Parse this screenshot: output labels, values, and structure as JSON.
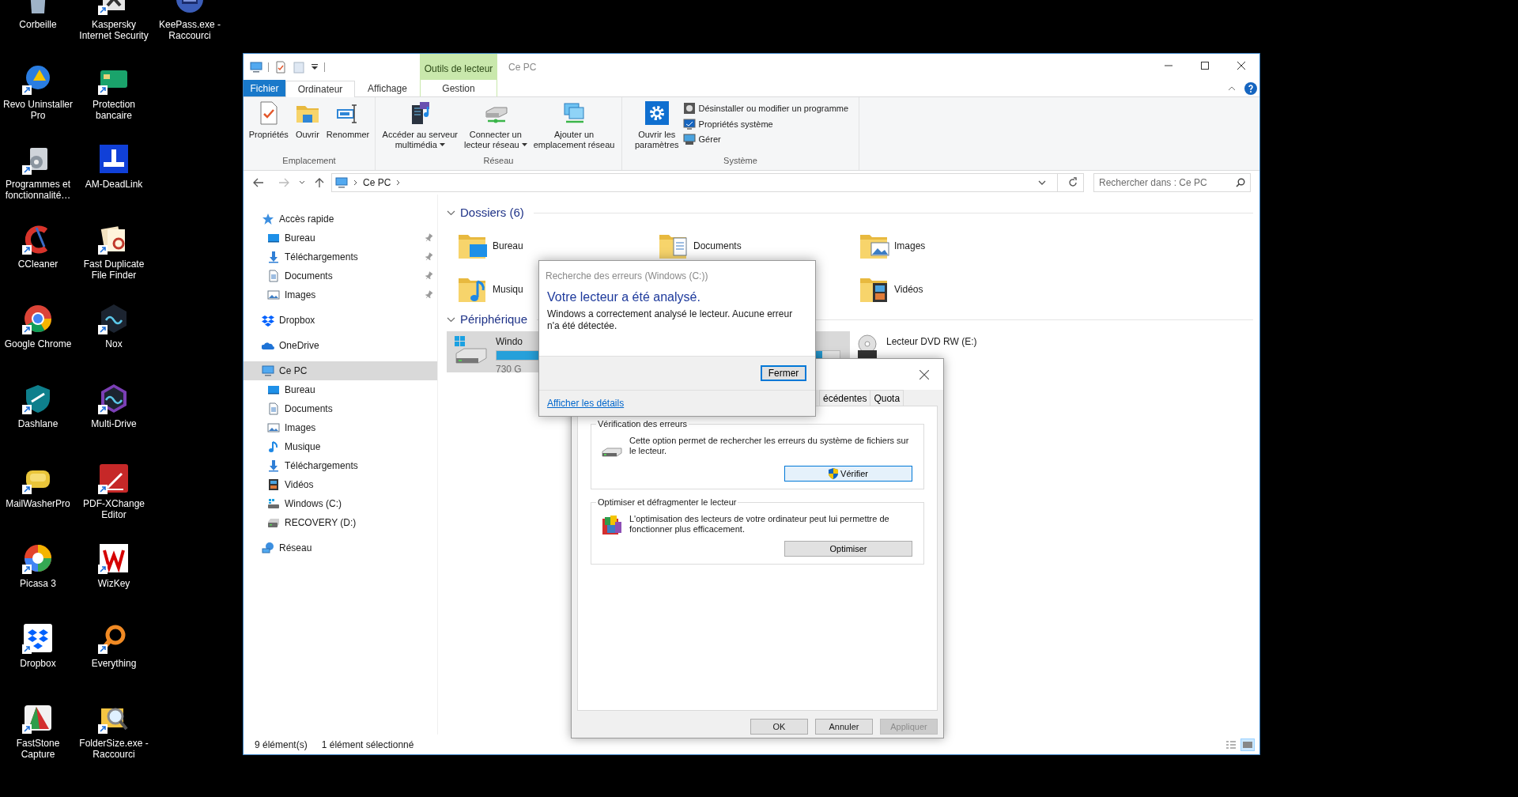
{
  "desktop": {
    "columns": [
      {
        "icons": [
          {
            "label": "Corbeille",
            "shortcut": false
          },
          {
            "label": "Revo Uninstaller Pro",
            "shortcut": true
          },
          {
            "label": "Programmes et fonctionnalité…",
            "shortcut": true
          },
          {
            "label": "CCleaner",
            "shortcut": true
          },
          {
            "label": "Google Chrome",
            "shortcut": true
          },
          {
            "label": "Dashlane",
            "shortcut": true
          },
          {
            "label": "MailWasherPro",
            "shortcut": true
          },
          {
            "label": "Picasa 3",
            "shortcut": true
          },
          {
            "label": "Dropbox",
            "shortcut": true
          },
          {
            "label": "FastStone Capture",
            "shortcut": true
          }
        ]
      },
      {
        "icons": [
          {
            "label": "Kaspersky Internet Security",
            "shortcut": true
          },
          {
            "label": "Protection bancaire",
            "shortcut": true
          },
          {
            "label": "AM-DeadLink",
            "shortcut": false
          },
          {
            "label": "Fast Duplicate File Finder",
            "shortcut": true
          },
          {
            "label": "Nox",
            "shortcut": true
          },
          {
            "label": "Multi-Drive",
            "shortcut": true
          },
          {
            "label": "PDF-XChange Editor",
            "shortcut": true
          },
          {
            "label": "WizKey",
            "shortcut": true
          },
          {
            "label": "Everything",
            "shortcut": true
          },
          {
            "label": "FolderSize.exe - Raccourci",
            "shortcut": true
          }
        ]
      },
      {
        "icons": [
          {
            "label": "KeePass.exe - Raccourci",
            "shortcut": false
          }
        ]
      }
    ]
  },
  "explorer": {
    "context_tab": "Outils de lecteur",
    "title": "Ce PC",
    "tabs": [
      {
        "label": "Fichier",
        "kind": "file",
        "selected": false
      },
      {
        "label": "Ordinateur",
        "kind": "normal",
        "selected": true
      },
      {
        "label": "Affichage",
        "kind": "normal",
        "selected": false
      },
      {
        "label": "Gestion",
        "kind": "context",
        "selected": false
      }
    ],
    "ribbon_groups": [
      {
        "title": "Emplacement",
        "items": [
          {
            "kind": "large",
            "lines": [
              "Propriétés"
            ],
            "dropdown": false
          },
          {
            "kind": "large",
            "lines": [
              "Ouvrir"
            ],
            "dropdown": false
          },
          {
            "kind": "large",
            "lines": [
              "Renommer"
            ],
            "dropdown": false
          }
        ]
      },
      {
        "title": "Réseau",
        "items": [
          {
            "kind": "large",
            "lines": [
              "Accéder au serveur",
              "multimédia"
            ],
            "dropdown": true
          },
          {
            "kind": "large",
            "lines": [
              "Connecter un",
              "lecteur réseau"
            ],
            "dropdown": true
          },
          {
            "kind": "large",
            "lines": [
              "Ajouter un",
              "emplacement réseau"
            ],
            "dropdown": false
          }
        ]
      },
      {
        "title": "Système",
        "items": [
          {
            "kind": "large",
            "lines": [
              "Ouvrir les",
              "paramètres"
            ],
            "dropdown": false
          },
          {
            "kind": "small",
            "lines": [
              "Désinstaller ou modifier un programme"
            ],
            "dropdown": false
          },
          {
            "kind": "small",
            "lines": [
              "Propriétés système"
            ],
            "dropdown": false
          },
          {
            "kind": "small",
            "lines": [
              "Gérer"
            ],
            "dropdown": false
          }
        ]
      }
    ],
    "address": {
      "crumbs": [
        "Ce PC"
      ]
    },
    "search": {
      "placeholder": "Rechercher dans : Ce PC"
    },
    "nav": [
      {
        "label": "Accès rapide",
        "kind": "star",
        "selected": false,
        "children": [
          {
            "label": "Bureau",
            "kind": "desktop",
            "pinned": true,
            "selected": false
          },
          {
            "label": "Téléchargements",
            "kind": "download",
            "pinned": true,
            "selected": false
          },
          {
            "label": "Documents",
            "kind": "document",
            "pinned": true,
            "selected": false
          },
          {
            "label": "Images",
            "kind": "images",
            "pinned": true,
            "selected": false
          }
        ]
      },
      {
        "label": "Dropbox",
        "kind": "dropbox",
        "selected": false
      },
      {
        "label": "OneDrive",
        "kind": "onedrive",
        "selected": false
      },
      {
        "label": "Ce PC",
        "kind": "pc",
        "selected": true,
        "children": [
          {
            "label": "Bureau",
            "kind": "desktop",
            "pinned": false,
            "selected": false
          },
          {
            "label": "Documents",
            "kind": "document",
            "pinned": false,
            "selected": false
          },
          {
            "label": "Images",
            "kind": "images",
            "pinned": false,
            "selected": false
          },
          {
            "label": "Musique",
            "kind": "music",
            "pinned": false,
            "selected": false
          },
          {
            "label": "Téléchargements",
            "kind": "download",
            "pinned": false,
            "selected": false
          },
          {
            "label": "Vidéos",
            "kind": "video",
            "pinned": false,
            "selected": false
          },
          {
            "label": "Windows (C:)",
            "kind": "windows-drive",
            "pinned": false,
            "selected": false
          },
          {
            "label": "RECOVERY (D:)",
            "kind": "drive",
            "pinned": false,
            "selected": false
          }
        ]
      },
      {
        "label": "Réseau",
        "kind": "network",
        "selected": false
      }
    ],
    "folders": {
      "title": "Dossiers (6)",
      "items": [
        {
          "label": "Bureau",
          "kind": "desktop"
        },
        {
          "label": "Documents",
          "kind": "document"
        },
        {
          "label": "Images",
          "kind": "images"
        },
        {
          "label": "Musiqu",
          "kind": "music"
        },
        {
          "label": "Vidéos",
          "kind": "video"
        }
      ]
    },
    "devices": {
      "title": "Périphérique",
      "items": [
        {
          "label": "Windo",
          "detail": "730 G",
          "kind": "windows-drive",
          "level": 0.95,
          "selected": true
        },
        {
          "label": "Lecteur DVD RW (E:)",
          "kind": "dvd",
          "selected": false
        }
      ]
    },
    "status_bar": {
      "items": [
        "9 élément(s)",
        "1 élément sélectionné"
      ]
    }
  },
  "properties_dialog": {
    "tabs": [
      {
        "label": "écédentes",
        "selected": false
      },
      {
        "label": "Quota",
        "selected": false
      }
    ],
    "groups": [
      {
        "title": "Vérification des erreurs",
        "text": "Cette option permet de rechercher les erreurs du système de fichiers sur le lecteur.",
        "button": "Vérifier",
        "shield": true,
        "focused": true,
        "kind": "drive"
      },
      {
        "title": "Optimiser et défragmenter le lecteur",
        "text": "L'optimisation des lecteurs de votre ordinateur peut lui permettre de fonctionner plus efficacement.",
        "button": "Optimiser",
        "shield": false,
        "focused": false,
        "kind": "defrag"
      }
    ],
    "buttons": [
      {
        "label": "OK",
        "disabled": false
      },
      {
        "label": "Annuler",
        "disabled": false
      },
      {
        "label": "Appliquer",
        "disabled": true
      }
    ]
  },
  "error_dialog": {
    "title": "Recherche des erreurs (Windows (C:))",
    "heading": "Votre lecteur a été analysé.",
    "message": "Windows a correctement analysé le lecteur. Aucune erreur n'a été détectée.",
    "button": "Fermer",
    "link": "Afficher les détails"
  }
}
